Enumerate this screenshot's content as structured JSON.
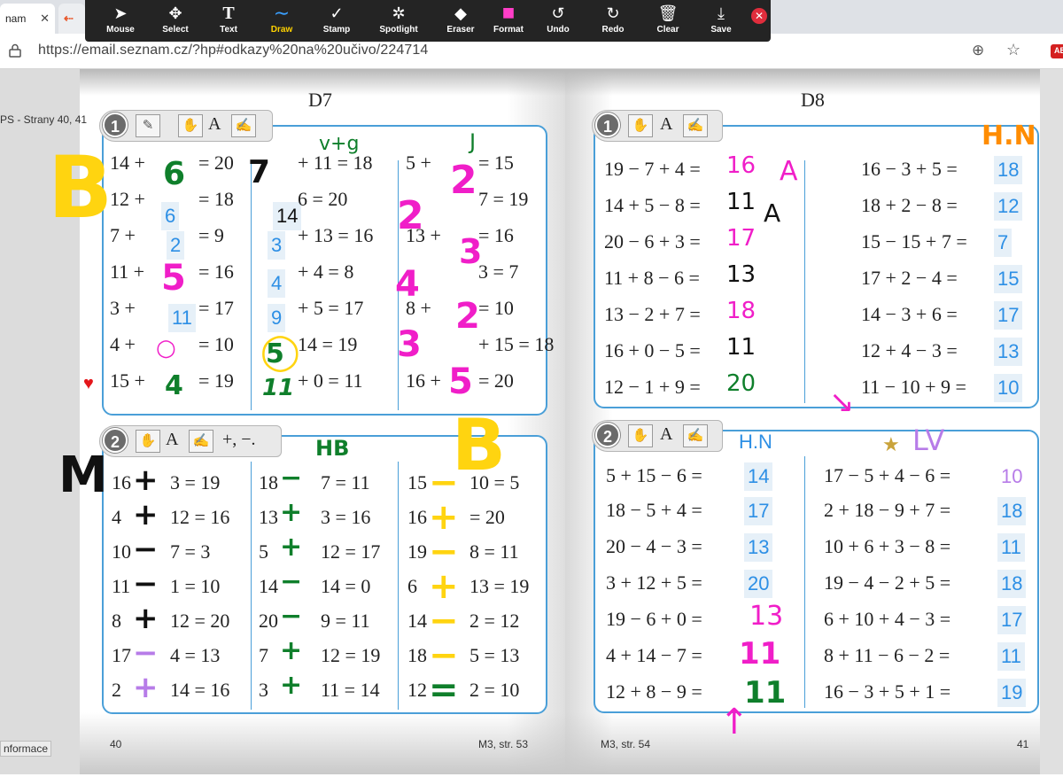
{
  "browser": {
    "tabs": [
      {
        "label": "nam",
        "close": "✕"
      },
      {
        "label": "",
        "favicon": "⇠"
      }
    ],
    "url": "https://email.seznam.cz/?hp#odkazy%20na%20učivo/224714",
    "extension_badge": "AB"
  },
  "annotation_toolbar": {
    "tools": [
      {
        "label": "Mouse",
        "icon": "➤"
      },
      {
        "label": "Select",
        "icon": "✥"
      },
      {
        "label": "Text",
        "icon": "T"
      },
      {
        "label": "Draw",
        "icon": "∼",
        "active": true
      },
      {
        "label": "Stamp",
        "icon": "✓"
      },
      {
        "label": "Spotlight",
        "icon": "✲"
      },
      {
        "label": "Eraser",
        "icon": "◆"
      },
      {
        "label": "Format",
        "icon": "■"
      },
      {
        "label": "Undo",
        "icon": "↺"
      },
      {
        "label": "Redo",
        "icon": "↻"
      },
      {
        "label": "Clear",
        "icon": "🗑"
      },
      {
        "label": "Save",
        "icon": "⤓"
      }
    ],
    "close": "✕",
    "format_color": "#ff3ec8"
  },
  "viewer": {
    "side_label_top": "PS - Strany 40, 41",
    "side_label_bottom": "nformace",
    "page_left_heading": "D7",
    "page_right_heading": "D8",
    "footer_left_page": "40",
    "footer_left_ref": "M3, str. 53",
    "footer_right_ref": "M3, str. 54",
    "footer_right_page": "41"
  },
  "d7_ex1": {
    "number": "1",
    "header_text": "A",
    "col1": [
      "14 +",
      "= 20",
      "12 +",
      "= 18",
      "7 +",
      "=  9",
      "11 +",
      "= 16",
      "3 +",
      "= 17",
      "4 +",
      "= 10",
      "15 +",
      "= 19"
    ],
    "col1_rows": [
      {
        "l": "14 +",
        "r": "= 20"
      },
      {
        "l": "12 +",
        "r": "= 18"
      },
      {
        "l": "7 +",
        "r": "=  9"
      },
      {
        "l": "11 +",
        "r": "= 16"
      },
      {
        "l": "3 +",
        "r": "= 17"
      },
      {
        "l": "4 +",
        "r": "= 10"
      },
      {
        "l": "15 +",
        "r": "= 19"
      }
    ],
    "col2_rows": [
      {
        "r": "+ 11 = 18"
      },
      {
        "r": "6 = 20"
      },
      {
        "r": "+ 13 = 16"
      },
      {
        "r": "+  4 =  8"
      },
      {
        "r": "+  5 = 17"
      },
      {
        "r": "14 = 19"
      },
      {
        "r": "+  0 = 11"
      }
    ],
    "col3_rows": [
      {
        "l": "5 +",
        "r": "= 15"
      },
      {
        "l": "",
        "r": "7 = 19"
      },
      {
        "l": "13 +",
        "r": "= 16"
      },
      {
        "l": "",
        "r": "3 =  7"
      },
      {
        "l": "8 +",
        "r": "= 10"
      },
      {
        "l": "",
        "r": "+ 15 = 18"
      },
      {
        "l": "16 +",
        "r": "= 20"
      }
    ],
    "typed_answers": {
      "c1": [
        "6",
        "2",
        "11"
      ],
      "c2": [
        "14",
        "3",
        "4",
        "9"
      ]
    },
    "handwriting": {
      "top_label": "v+g",
      "c1": [
        "6",
        "5",
        "4"
      ],
      "c2_a": "7",
      "c2_b": "5",
      "c2_c": "11",
      "c3": [
        "2",
        "2",
        "4",
        "3",
        "2",
        "3",
        "5"
      ],
      "letter_B": "B",
      "letter_J": "J"
    }
  },
  "d7_ex2": {
    "number": "2",
    "header_text": "A",
    "header_ops": "+, −.",
    "col1_rows": [
      {
        "l": "16",
        "r": "3 = 19"
      },
      {
        "l": "4",
        "r": "12 = 16"
      },
      {
        "l": "10",
        "r": "7 =  3"
      },
      {
        "l": "11",
        "r": "1 = 10"
      },
      {
        "l": "8",
        "r": "12 = 20"
      },
      {
        "l": "17",
        "r": "4 = 13"
      },
      {
        "l": "2",
        "r": "14 = 16"
      }
    ],
    "col2_rows": [
      {
        "l": "18",
        "r": "7 = 11"
      },
      {
        "l": "13",
        "r": "3 = 16"
      },
      {
        "l": "5",
        "r": "12 = 17"
      },
      {
        "l": "14",
        "r": "14 =  0"
      },
      {
        "l": "20",
        "r": "9 = 11"
      },
      {
        "l": "7",
        "r": "12 = 19"
      },
      {
        "l": "3",
        "r": "11 = 14"
      }
    ],
    "col3_rows": [
      {
        "l": "15",
        "r": "10 =  5"
      },
      {
        "l": "16",
        "r": "= 20"
      },
      {
        "l": "19",
        "r": "8 = 11"
      },
      {
        "l": "6",
        "r": "13 = 19"
      },
      {
        "l": "14",
        "r": "2 = 12"
      },
      {
        "l": "18",
        "r": "5 = 13"
      },
      {
        "l": "12",
        "r": "2 = 10"
      }
    ],
    "handwriting": {
      "label_M": "M",
      "label_HB": "HB",
      "label_B": "B",
      "c1": [
        "+",
        "+",
        "−",
        "−",
        "+",
        "−",
        "+"
      ],
      "c2": [
        "−",
        "+",
        "+",
        "−",
        "−",
        "+",
        "+"
      ],
      "c3": [
        "−",
        "+",
        "−",
        "+",
        "−",
        "−",
        "="
      ]
    }
  },
  "d8_ex1": {
    "number": "1",
    "header_text": "A",
    "left_rows": [
      "19 − 7 + 4 =",
      "14 + 5 − 8 =",
      "20 − 6 + 3 =",
      "11 + 8 − 6 =",
      "13 − 2 + 7 =",
      "16 + 0 − 5 =",
      "12 − 1 + 9 ="
    ],
    "left_handwriting": [
      "16",
      "11",
      "17",
      "13",
      "18",
      "11",
      "20"
    ],
    "marks": {
      "A1": "A",
      "A2": "A"
    },
    "right_rows": [
      "16 −  3 + 5 =",
      "18 +  2 − 8 =",
      "15 − 15 + 7 =",
      "17 +  2 − 4 =",
      "14 −  3 + 6 =",
      "12 +  4 − 3 =",
      "11 − 10 + 9 ="
    ],
    "right_answers": [
      "18",
      "12",
      "7",
      "15",
      "17",
      "13",
      "10"
    ],
    "corner_label": "H.N"
  },
  "d8_ex2": {
    "number": "2",
    "header_text": "A",
    "label": "H.N",
    "label_violet": "LV",
    "left_rows": [
      "5 + 15 − 6 =",
      "18 −  5 + 4 =",
      "20 −  4 − 3 =",
      "3 + 12 + 5 =",
      "19 −  6 + 0 =",
      "4 + 14 − 7 =",
      "12 +  8 − 9 ="
    ],
    "left_answers": [
      "14",
      "17",
      "13",
      "20"
    ],
    "left_handwriting": [
      "13",
      "11",
      "11"
    ],
    "right_rows": [
      "17 −  5 + 4 − 6 =",
      "2 + 18 − 9 + 7 =",
      "10 +  6 + 3 − 8 =",
      "19 −  4 − 2 + 5 =",
      "6 + 10 + 4 − 3 =",
      "8 + 11 − 6 − 2 =",
      "16 −  3 + 5 + 1 ="
    ],
    "right_answers": [
      "10",
      "18",
      "11",
      "18",
      "17",
      "11",
      "19"
    ]
  },
  "colors": {
    "blue_answer": "#2d8fe5",
    "box_border": "#4a9fd8",
    "pink_pen": "#f01ec8",
    "green_pen": "#0f7f2b",
    "yellow_pen": "#ffd410",
    "black_pen": "#111111",
    "violet_pen": "#b77ce8",
    "orange_pen": "#ff8c00"
  }
}
